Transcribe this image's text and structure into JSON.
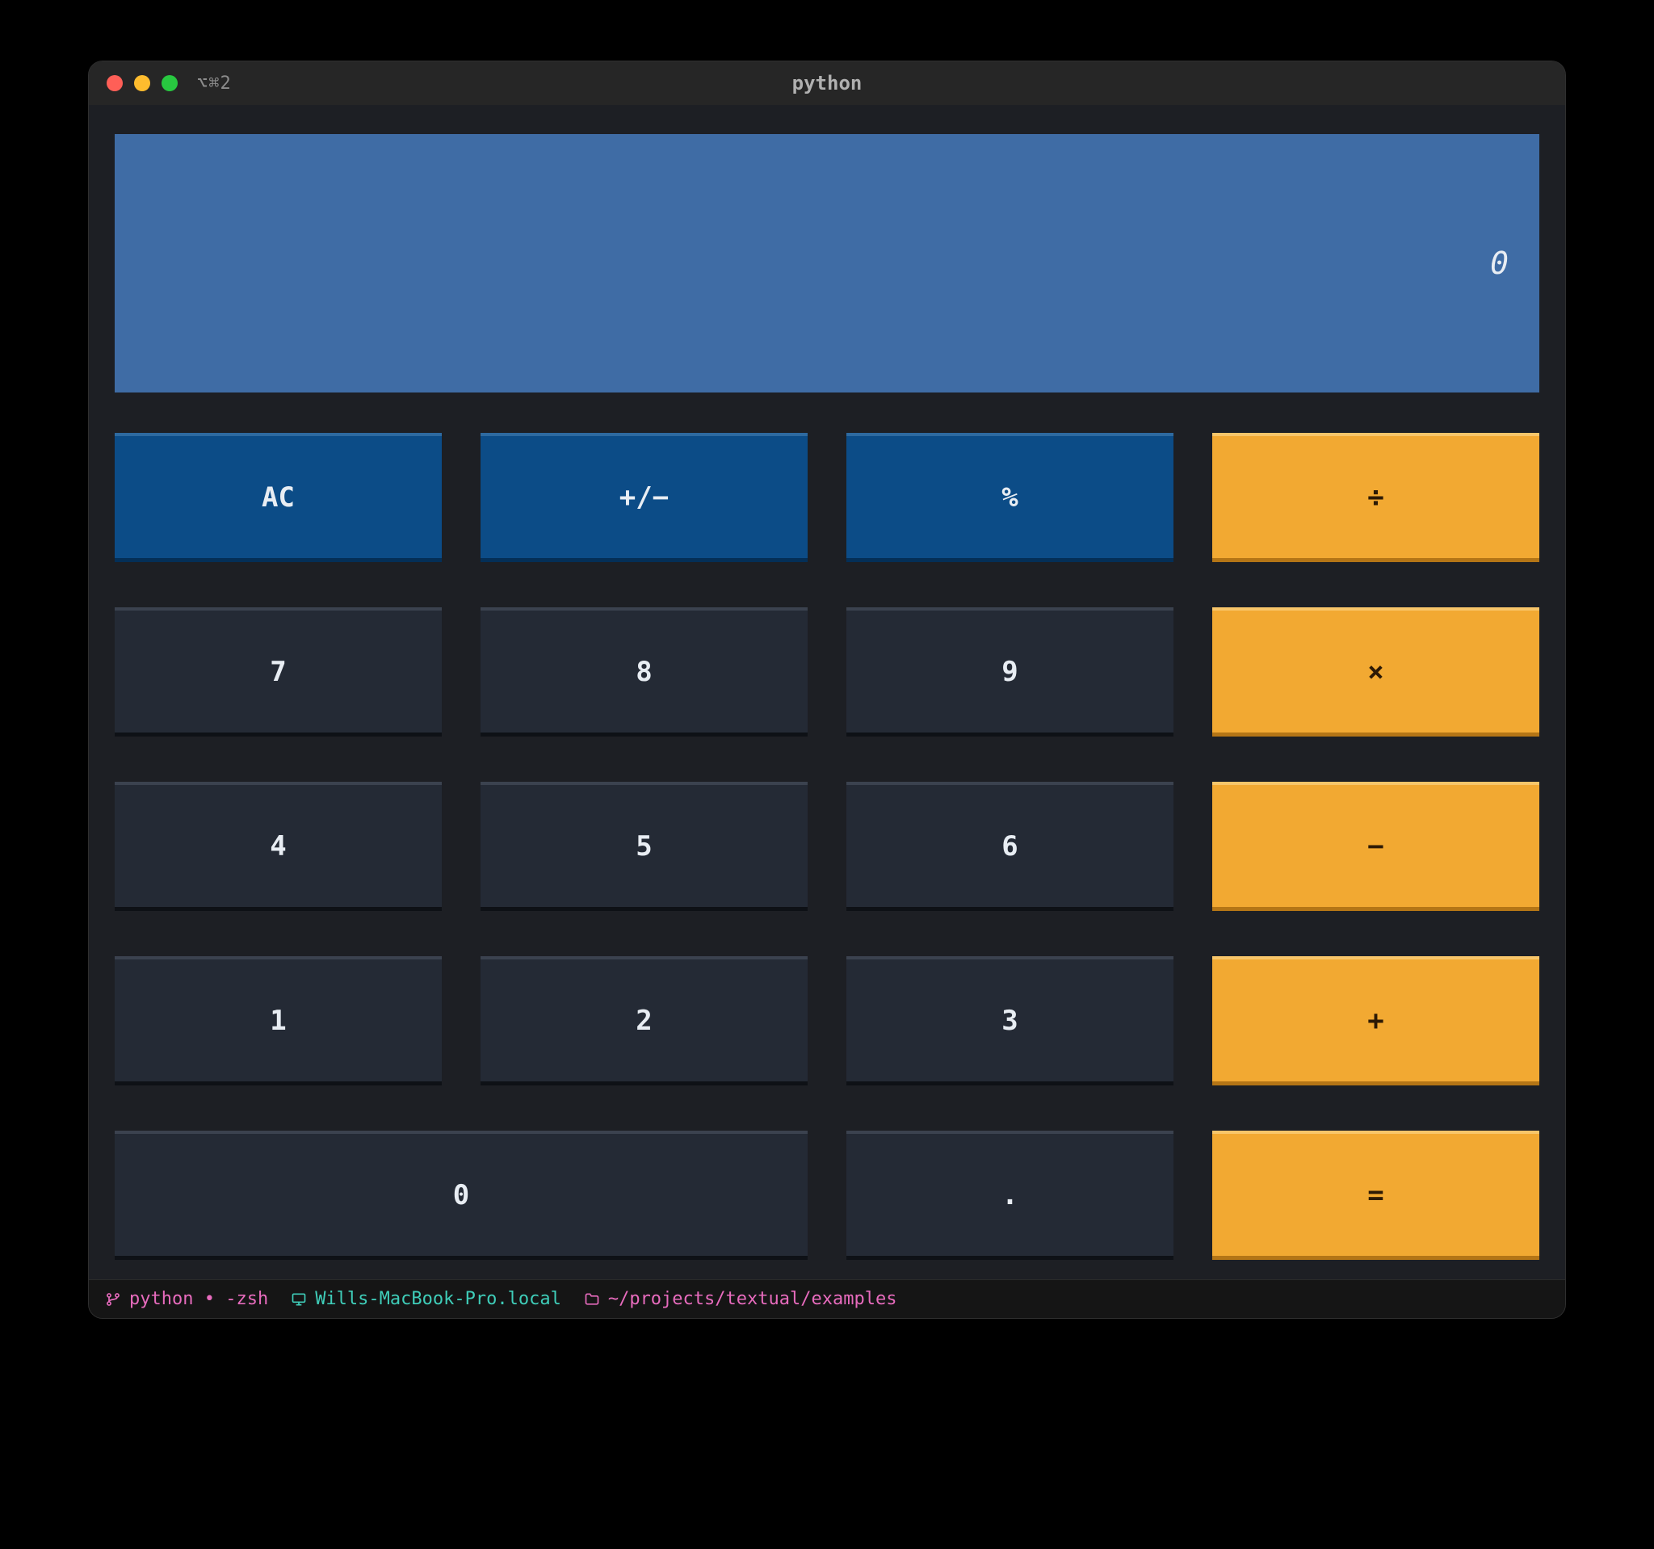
{
  "window": {
    "title": "python",
    "shortcut_hint": "⌥⌘2"
  },
  "display": {
    "value": "0"
  },
  "buttons": {
    "ac": "AC",
    "plusminus": "+/−",
    "percent": "%",
    "divide": "÷",
    "seven": "7",
    "eight": "8",
    "nine": "9",
    "multiply": "×",
    "four": "4",
    "five": "5",
    "six": "6",
    "minus": "−",
    "one": "1",
    "two": "2",
    "three": "3",
    "plus": "+",
    "zero": "0",
    "dot": ".",
    "equals": "="
  },
  "statusbar": {
    "process": "python • -zsh",
    "host": "Wills-MacBook-Pro.local",
    "path": "~/projects/textual/examples"
  },
  "colors": {
    "display_bg": "#3f6ca5",
    "fn_bg": "#0c4c87",
    "num_bg": "#242a35",
    "op_bg": "#f2a932"
  }
}
